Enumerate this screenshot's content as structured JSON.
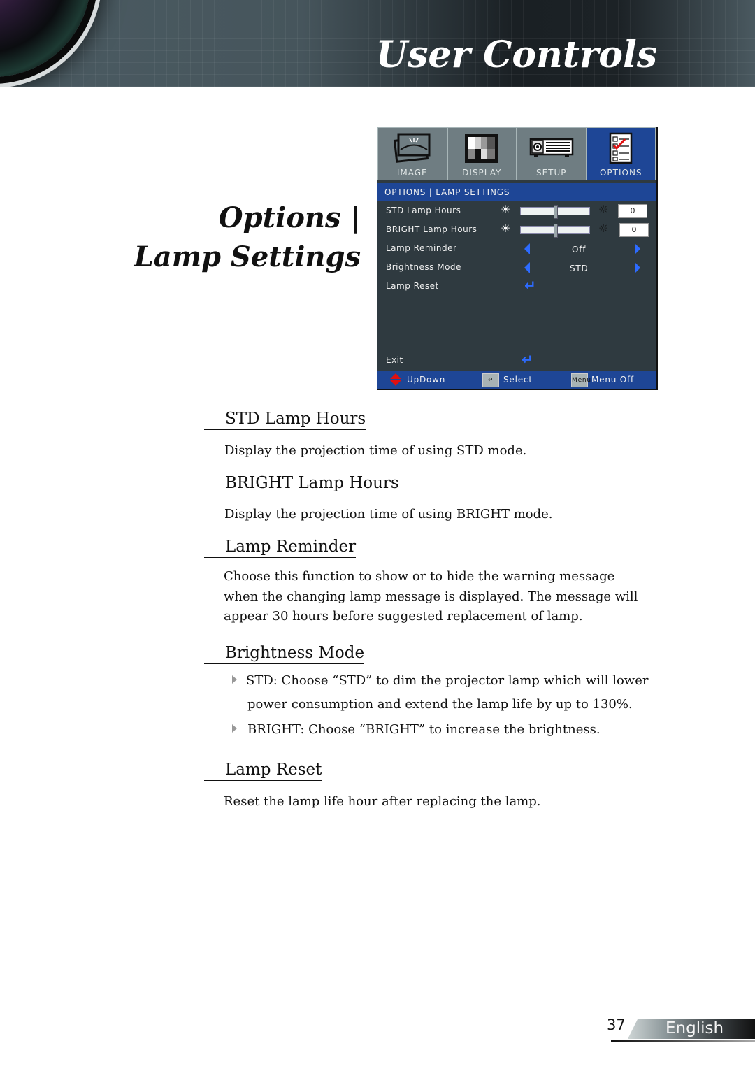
{
  "header": {
    "title": "User Controls"
  },
  "section": {
    "title_line1": "Options |",
    "title_line2": "Lamp Settings"
  },
  "osd": {
    "tabs": [
      {
        "label": "IMAGE",
        "icon": "image-icon",
        "active": false
      },
      {
        "label": "DISPLAY",
        "icon": "display-icon",
        "active": false
      },
      {
        "label": "SETUP",
        "icon": "setup-projector-icon",
        "active": false
      },
      {
        "label": "OPTIONS",
        "icon": "options-checklist-icon",
        "active": true
      }
    ],
    "breadcrumb": "OPTIONS | LAMP SETTINGS",
    "rows": [
      {
        "label": "STD Lamp Hours",
        "value": "0",
        "slider_fraction": 0.5
      },
      {
        "label": "BRIGHT Lamp Hours",
        "value": "0",
        "slider_fraction": 0.5
      },
      {
        "label": "Lamp Reminder",
        "value": "Off"
      },
      {
        "label": "Brightness Mode",
        "value": "STD"
      },
      {
        "label": "Lamp Reset"
      }
    ],
    "exit_label": "Exit",
    "footer": {
      "updown": "UpDown",
      "select": "Select",
      "menu_key": "Menu",
      "menu_off": "Menu Off"
    },
    "colors": {
      "accent_blue": "#1e4696",
      "arrow_blue": "#2d6bff",
      "panel_bg": "#2f3a40"
    }
  },
  "sections": [
    {
      "heading": "STD Lamp Hours",
      "text": "Display the projection time of using STD mode."
    },
    {
      "heading": "BRIGHT Lamp Hours",
      "text": "Display the projection time of using BRIGHT mode."
    },
    {
      "heading": "Lamp Reminder",
      "lines": [
        "Choose this function to show or to hide the warning message",
        "when the changing lamp message is displayed. The message will",
        "appear 30 hours before suggested replacement of lamp."
      ]
    },
    {
      "heading": "Brightness Mode",
      "bullets": [
        {
          "line1": "STD: Choose “STD” to dim the projector lamp which will lower",
          "line2": "power consumption and extend the lamp life by up to 130%."
        },
        {
          "line1": "BRIGHT: Choose “BRIGHT” to increase the brightness."
        }
      ]
    },
    {
      "heading": "Lamp Reset",
      "text": "Reset the lamp life hour after replacing the lamp."
    }
  ],
  "footer": {
    "page_number": "37",
    "language": "English"
  }
}
